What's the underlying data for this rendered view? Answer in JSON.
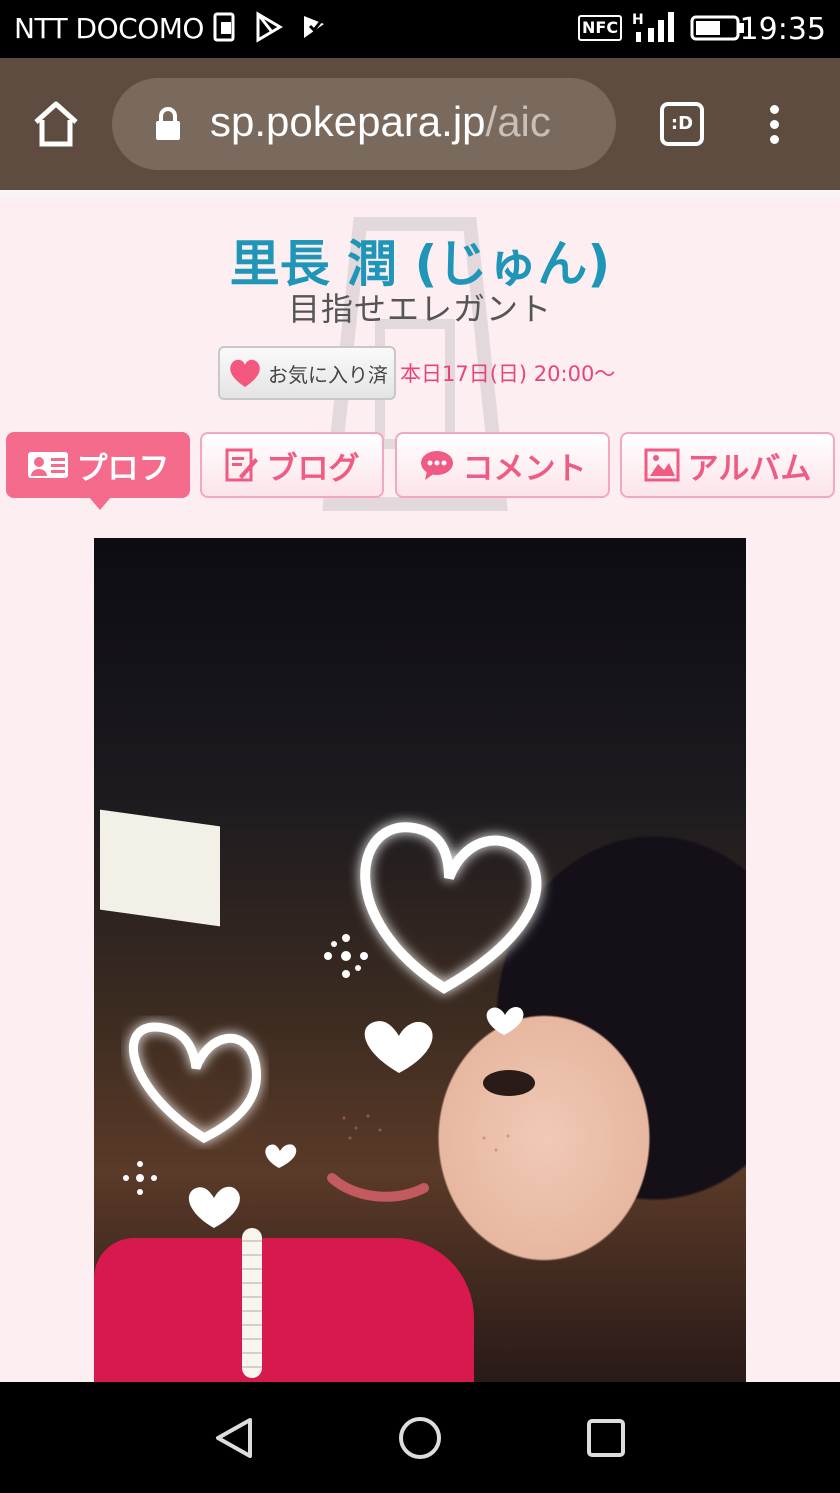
{
  "status_bar": {
    "carrier": "NTT DOCOMO",
    "time": "19:35",
    "nfc_label": "NFC",
    "network_label": "H"
  },
  "browser": {
    "url_main": "sp.pokepara.jp",
    "url_rest": "/aic",
    "tab_switcher_label": ":D"
  },
  "profile": {
    "name": "里長 潤 (じゅん)",
    "catchphrase": "目指せエレガント",
    "favorite_button": "お気に入り済",
    "schedule": "本日17日(日) 20:00〜"
  },
  "tabs": [
    {
      "label": "プロフ",
      "active": true
    },
    {
      "label": "ブログ",
      "active": false
    },
    {
      "label": "コメント",
      "active": false
    },
    {
      "label": "アルバム",
      "active": false
    }
  ],
  "colors": {
    "accent": "#f46b8c",
    "name_blue": "#1f96b8",
    "toolbar_brown": "#5d4c3f"
  }
}
